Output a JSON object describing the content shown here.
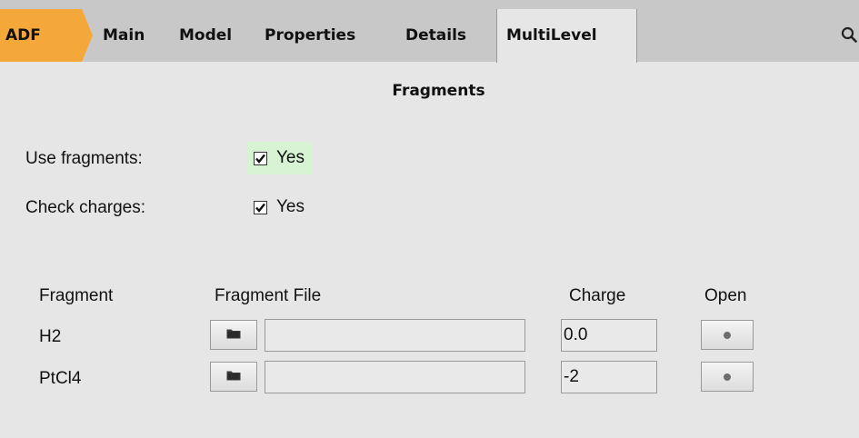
{
  "tabs": {
    "adf": "ADF",
    "main": "Main",
    "model": "Model",
    "properties": "Properties",
    "details": "Details",
    "multilevel": "MultiLevel",
    "active": "MultiLevel"
  },
  "section_title": "Fragments",
  "use_fragments": {
    "label": "Use fragments:",
    "checked": true,
    "text": "Yes"
  },
  "check_charges": {
    "label": "Check charges:",
    "checked": true,
    "text": "Yes"
  },
  "table": {
    "headers": {
      "fragment": "Fragment",
      "file": "Fragment File",
      "charge": "Charge",
      "open": "Open"
    },
    "rows": [
      {
        "fragment": "H2",
        "file": "",
        "charge": "0.0"
      },
      {
        "fragment": "PtCl4",
        "file": "",
        "charge": "-2"
      }
    ]
  },
  "icons": {
    "search": "search-icon",
    "folder": "folder-icon",
    "open": "radio-dot-icon"
  },
  "colors": {
    "adf_tab": "#f5a83a",
    "tabbar": "#c8c8c8",
    "background": "#e6e6e6",
    "highlight": "#d7f3d4"
  }
}
